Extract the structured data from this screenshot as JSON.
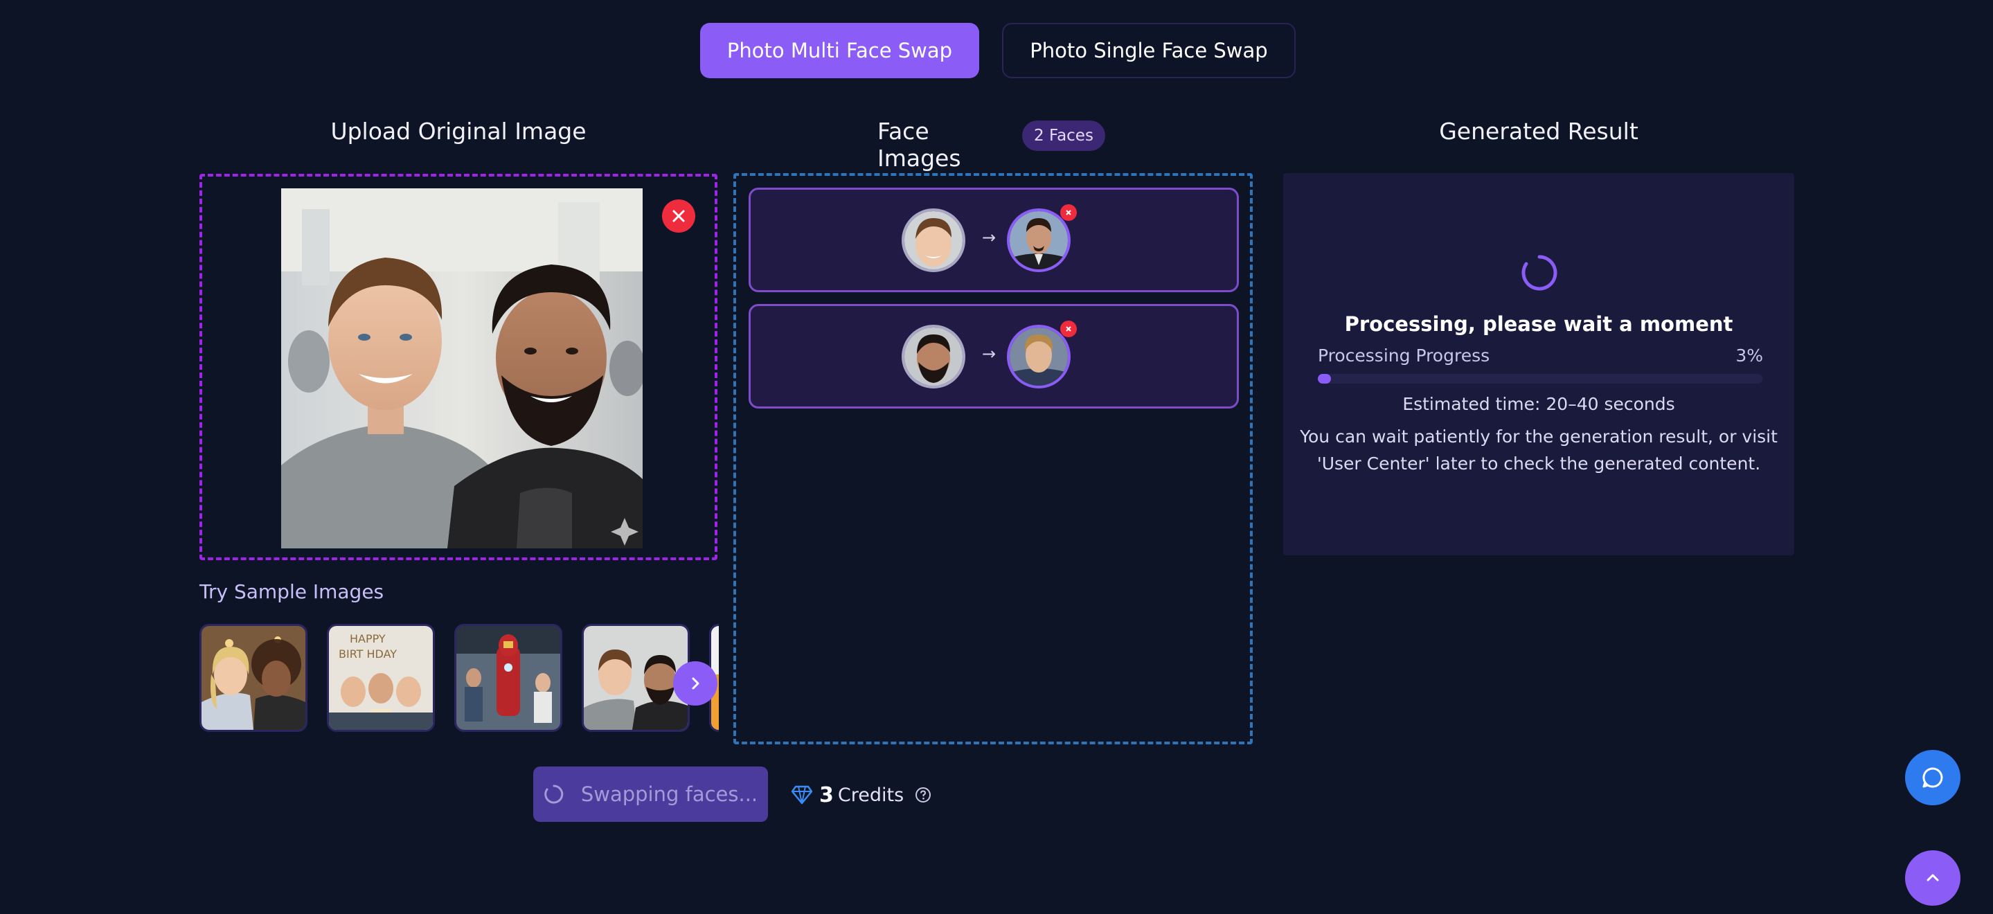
{
  "tabs": {
    "multi": "Photo Multi Face Swap",
    "single": "Photo Single Face Swap"
  },
  "columns": {
    "upload_title": "Upload Original Image",
    "faces_title": "Face Images",
    "faces_badge": "2 Faces",
    "result_title": "Generated Result"
  },
  "samples": {
    "title": "Try Sample Images"
  },
  "processing": {
    "title": "Processing, please wait a moment",
    "progress_label": "Processing Progress",
    "progress_text": "3%",
    "progress_value": 0.03,
    "estimate": "Estimated time: 20–40 seconds",
    "hint_line1": "You can wait patiently for the generation result, or visit",
    "hint_line2": "'User Center' later to check the generated content."
  },
  "actions": {
    "swap_label": "Swapping faces...",
    "credits_value": "3",
    "credits_label": "Credits"
  },
  "colors": {
    "accent": "#8b5cf6",
    "danger": "#ef2c3e",
    "chat": "#2e7bf0",
    "background": "#0d1426"
  }
}
